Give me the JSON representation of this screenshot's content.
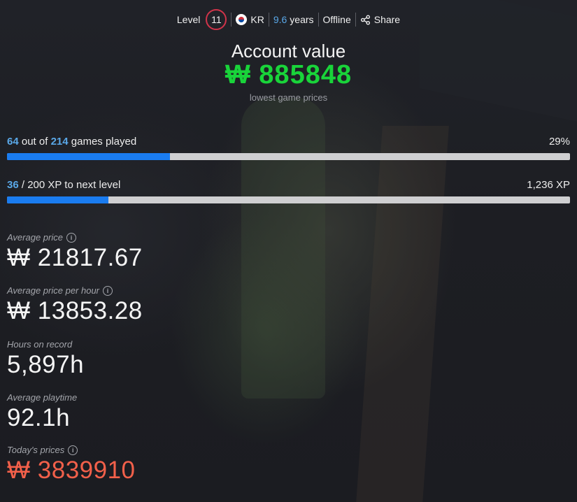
{
  "header": {
    "level_label": "Level",
    "level": "11",
    "country": "KR",
    "years_value": "9.6",
    "years_unit": "years",
    "status": "Offline",
    "share_label": "Share",
    "flag_icon": "korea-flag-icon",
    "share_icon": "share-icon"
  },
  "account": {
    "title": "Account value",
    "value": "₩ 885848",
    "subtitle": "lowest game prices",
    "value_color": "#19d43a"
  },
  "games_progress": {
    "played": "64",
    "text_mid": "out of",
    "total": "214",
    "text_end": "games played",
    "percent_label": "29%",
    "fraction": 0.29
  },
  "xp_progress": {
    "current": "36",
    "text_rest": "/ 200 XP to next level",
    "total_xp": "1,236 XP",
    "fraction": 0.18
  },
  "stats": {
    "avg_price_label": "Average price",
    "avg_price_value": "₩ 21817.67",
    "avg_price_hour_label": "Average price per hour",
    "avg_price_hour_value": "₩ 13853.28",
    "hours_label": "Hours on record",
    "hours_value": "5,897h",
    "avg_playtime_label": "Average playtime",
    "avg_playtime_value": "92.1h",
    "todays_label": "Today's prices",
    "todays_value": "₩ 3839910"
  },
  "colors": {
    "accent_blue": "#1a7cf0",
    "highlight_blue": "#5aa8e8",
    "level_ring": "#d0344a",
    "today_red": "#f2604a"
  }
}
